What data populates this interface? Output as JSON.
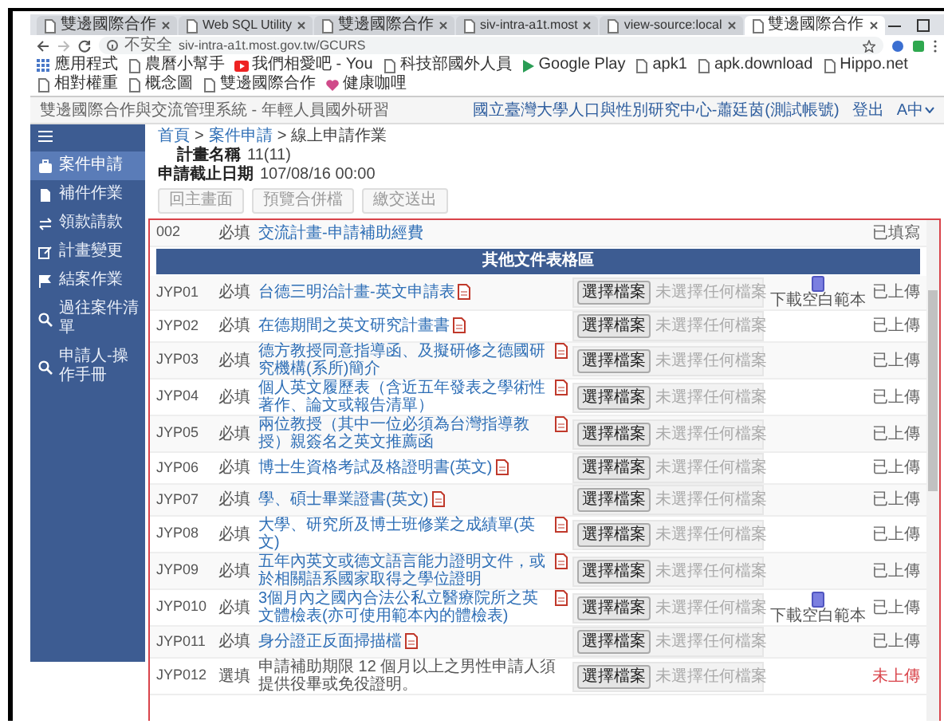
{
  "browser": {
    "tabs": [
      {
        "title": "雙邊國際合作",
        "selected": false
      },
      {
        "title": "Web SQL Utility",
        "selected": false
      },
      {
        "title": "雙邊國際合作",
        "selected": false
      },
      {
        "title": "siv-intra-a1t.most",
        "selected": false
      },
      {
        "title": "view-source:local",
        "selected": false
      },
      {
        "title": "雙邊國際合作",
        "selected": true
      }
    ],
    "security": "不安全",
    "url": "siv-intra-a1t.most.gov.tw/GCURS",
    "bookmarks": [
      {
        "label": "應用程式",
        "kind": "apps"
      },
      {
        "label": "農曆小幫手",
        "kind": "page"
      },
      {
        "label": "我們相愛吧 - You",
        "kind": "video"
      },
      {
        "label": "科技部國外人員",
        "kind": "page"
      },
      {
        "label": "Google Play",
        "kind": "play"
      },
      {
        "label": "apk1",
        "kind": "page"
      },
      {
        "label": "apk.download",
        "kind": "page"
      },
      {
        "label": "Hippo.net",
        "kind": "page"
      },
      {
        "label": "相對權重",
        "kind": "page"
      },
      {
        "label": "概念圖",
        "kind": "page"
      },
      {
        "label": "雙邊國際合作",
        "kind": "page"
      },
      {
        "label": "健康咖哩",
        "kind": "heart"
      }
    ]
  },
  "header": {
    "title": "雙邊國際合作與交流管理系統 - 年輕人員國外研習",
    "user": "國立臺灣大學人口與性別研究中心-蕭廷茵(測試帳號)",
    "logout": "登出",
    "language": "A中"
  },
  "sidebar": {
    "items": [
      {
        "label": "案件申請",
        "selected": true
      },
      {
        "label": "補件作業",
        "selected": false
      },
      {
        "label": "領款請款",
        "selected": false
      },
      {
        "label": "計畫變更",
        "selected": false
      },
      {
        "label": "結案作業",
        "selected": false
      },
      {
        "label": "過往案件清單",
        "selected": false
      },
      {
        "label": "申請人-操作手冊",
        "selected": false
      }
    ]
  },
  "breadcrumb": [
    {
      "label": "首頁",
      "kind": "link"
    },
    {
      "label": ">",
      "kind": "separator"
    },
    {
      "label": "案件申請",
      "kind": "link"
    },
    {
      "label": ">",
      "kind": "separator"
    },
    {
      "label": "線上申請作業",
      "kind": "current"
    }
  ],
  "fields": [
    {
      "label": "計畫名稱",
      "value": "11(11)"
    },
    {
      "label": "申請截止日期",
      "value": "107/08/16 00:00"
    }
  ],
  "buttons": [
    "回主畫面",
    "預覽合併檔",
    "繳交送出"
  ],
  "table": {
    "rows": [
      {
        "kind": "document",
        "code": "002",
        "required": "必填",
        "name": "交流計畫-申請補助經費",
        "link": true,
        "icon": false,
        "status": "已填寫",
        "uploaded": true
      },
      {
        "kind": "section",
        "title": "其他文件表格區"
      },
      {
        "kind": "document",
        "code": "JYP01",
        "required": "必填",
        "name": "台德三明治計畫-英文申請表",
        "link": true,
        "icon": true,
        "file": {
          "button": "選擇檔案",
          "status": "未選擇任何檔案"
        },
        "template": "下載空白範本",
        "status": "已上傳",
        "uploaded": true
      },
      {
        "kind": "document",
        "code": "JYP02",
        "required": "必填",
        "name": "在德期間之英文研究計畫書",
        "link": true,
        "icon": true,
        "file": {
          "button": "選擇檔案",
          "status": "未選擇任何檔案"
        },
        "status": "已上傳",
        "uploaded": true
      },
      {
        "kind": "document",
        "code": "JYP03",
        "required": "必填",
        "name": "德方教授同意指導函、及擬研修之德國研究機構(系所)簡介",
        "link": true,
        "icon": true,
        "file": {
          "button": "選擇檔案",
          "status": "未選擇任何檔案"
        },
        "status": "已上傳",
        "uploaded": true
      },
      {
        "kind": "document",
        "code": "JYP04",
        "required": "必填",
        "name": "個人英文履歷表（含近五年發表之學術性著作、論文或報告清單）",
        "link": true,
        "icon": true,
        "file": {
          "button": "選擇檔案",
          "status": "未選擇任何檔案"
        },
        "status": "已上傳",
        "uploaded": true
      },
      {
        "kind": "document",
        "code": "JYP05",
        "required": "必填",
        "name": "兩位教授（其中一位必須為台灣指導教授）親簽名之英文推薦函",
        "link": true,
        "icon": true,
        "file": {
          "button": "選擇檔案",
          "status": "未選擇任何檔案"
        },
        "status": "已上傳",
        "uploaded": true
      },
      {
        "kind": "document",
        "code": "JYP06",
        "required": "必填",
        "name": "博士生資格考試及格證明書(英文)",
        "link": true,
        "icon": true,
        "file": {
          "button": "選擇檔案",
          "status": "未選擇任何檔案"
        },
        "status": "已上傳",
        "uploaded": true
      },
      {
        "kind": "document",
        "code": "JYP07",
        "required": "必填",
        "name": "學、碩士畢業證書(英文)",
        "link": true,
        "icon": true,
        "file": {
          "button": "選擇檔案",
          "status": "未選擇任何檔案"
        },
        "status": "已上傳",
        "uploaded": true
      },
      {
        "kind": "document",
        "code": "JYP08",
        "required": "必填",
        "name": "大學、研究所及博士班修業之成績單(英文)",
        "link": true,
        "icon": true,
        "file": {
          "button": "選擇檔案",
          "status": "未選擇任何檔案"
        },
        "status": "已上傳",
        "uploaded": true
      },
      {
        "kind": "document",
        "code": "JYP09",
        "required": "必填",
        "name": "五年內英文或德文語言能力證明文件，或於相關語系國家取得之學位證明",
        "link": true,
        "icon": true,
        "file": {
          "button": "選擇檔案",
          "status": "未選擇任何檔案"
        },
        "status": "已上傳",
        "uploaded": true
      },
      {
        "kind": "document",
        "code": "JYP010",
        "required": "必填",
        "name": "3個月內之國內合法公私立醫療院所之英文體檢表(亦可使用範本內的體檢表)",
        "link": true,
        "icon": true,
        "file": {
          "button": "選擇檔案",
          "status": "未選擇任何檔案"
        },
        "template": "下載空白範本",
        "status": "已上傳",
        "uploaded": true
      },
      {
        "kind": "document",
        "code": "JYP011",
        "required": "必填",
        "name": "身分證正反面掃描檔",
        "link": true,
        "icon": true,
        "file": {
          "button": "選擇檔案",
          "status": "未選擇任何檔案"
        },
        "status": "已上傳",
        "uploaded": true
      },
      {
        "kind": "document",
        "code": "JYP012",
        "required": "選填",
        "name": "申請補助期限 12 個月以上之男性申請人須提供役畢或免役證明。",
        "link": false,
        "icon": false,
        "file": {
          "button": "選擇檔案",
          "status": "未選擇任何檔案"
        },
        "status": "未上傳",
        "uploaded": false
      }
    ]
  }
}
